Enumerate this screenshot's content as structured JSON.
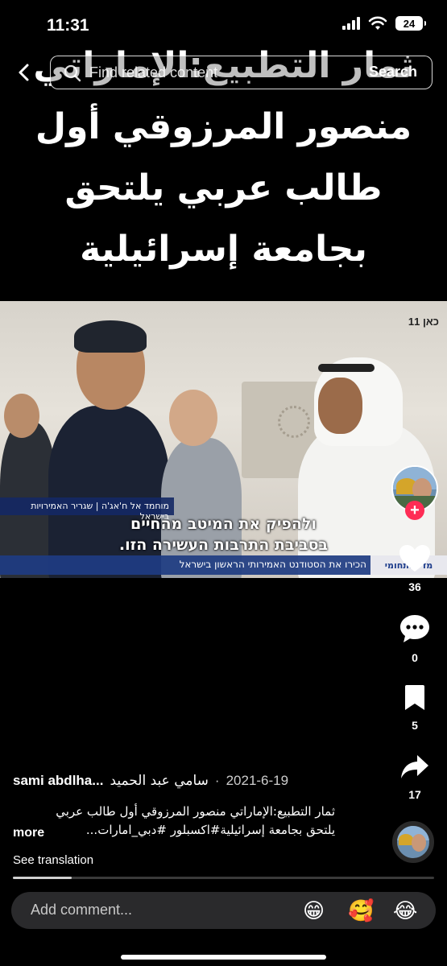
{
  "status_bar": {
    "time": "11:31",
    "battery": "24"
  },
  "search": {
    "placeholder": "Find related content",
    "button_label": "Search"
  },
  "overlay_title": {
    "line1": "ثمار التطبيع:الإماراتي",
    "line2": "منصور المرزوقي أول",
    "line3": "طالب عربي يلتحق",
    "line4": "بجامعة إسرائيلية"
  },
  "video": {
    "caption_line1": "ולהפיק את המיטב מהחיים",
    "caption_line2": "בסביבת התרבות העשירה הזו.",
    "name_tag": "מוחמד אל ח'אג'ה | שגריר האמירויות בישראל",
    "lower_third": "הכירו את הסטודנט האמירותי הראשון בישראל",
    "lower_third_brand": "מדע ותחומי",
    "channel_logo": "כאן 11"
  },
  "actions": {
    "likes": "36",
    "comments": "0",
    "saves": "5",
    "shares": "17"
  },
  "post": {
    "author_latin": "sami abdlha...",
    "author_arabic": "سامي عبد الحميد",
    "date": "2021-6-19",
    "caption_line1": "ثمار التطبيع:الإماراتي منصور المرزوقي أول طالب عربي",
    "caption_line2": "يلتحق بجامعة إسرائيلية#اكسبلور #دبي_امارات...",
    "more": "more",
    "see_translation": "See translation",
    "progress": 0.14
  },
  "comment_bar": {
    "placeholder": "Add comment...",
    "emoji1": "😁",
    "emoji2": "🥰",
    "emoji3": "😂"
  },
  "colors": {
    "accent": "#fe2c55",
    "background": "#000000"
  }
}
